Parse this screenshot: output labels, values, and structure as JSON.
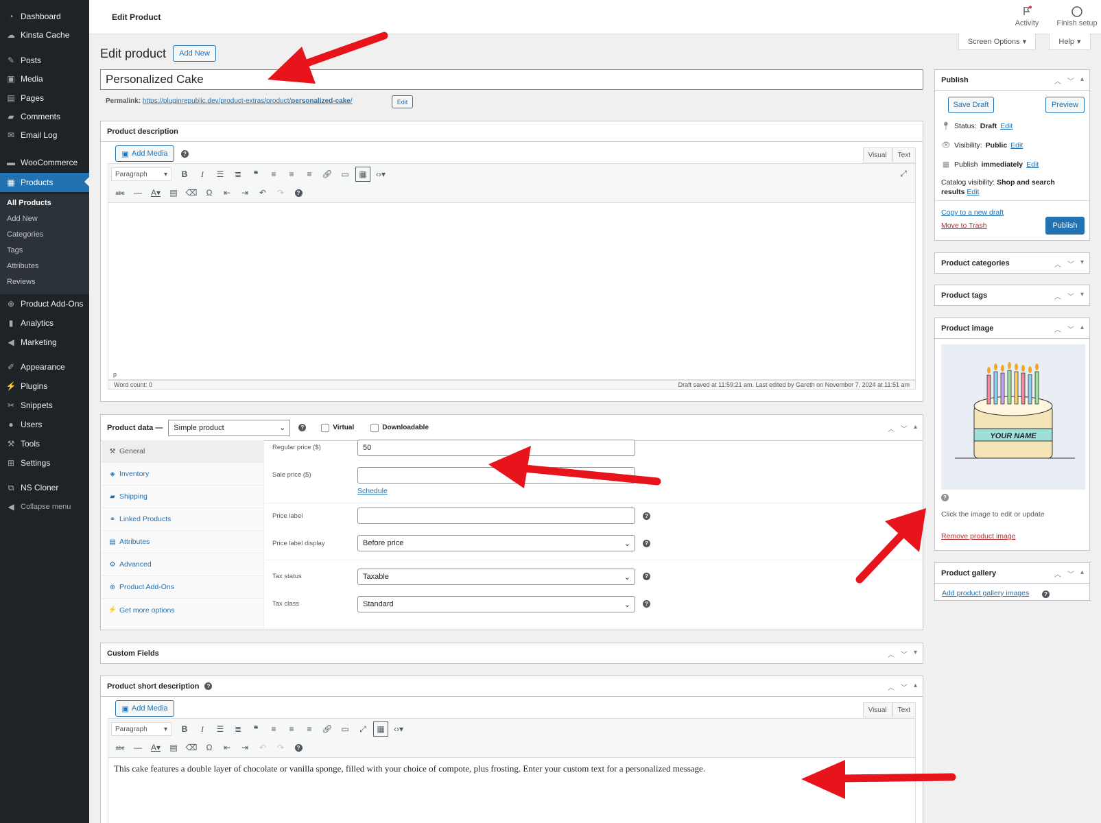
{
  "sidebar": {
    "menu": [
      {
        "label": "Dashboard",
        "icon": "dashboard-icon"
      },
      {
        "label": "Kinsta Cache",
        "icon": "cloud-icon"
      },
      {
        "label": "Posts",
        "icon": "pin-icon"
      },
      {
        "label": "Media",
        "icon": "media-icon"
      },
      {
        "label": "Pages",
        "icon": "pages-icon"
      },
      {
        "label": "Comments",
        "icon": "comments-icon"
      },
      {
        "label": "Email Log",
        "icon": "email-icon"
      },
      {
        "label": "WooCommerce",
        "icon": "woocommerce-icon"
      },
      {
        "label": "Products",
        "icon": "products-icon"
      },
      {
        "label": "Product Add-Ons",
        "icon": "plus-circle-icon"
      },
      {
        "label": "Analytics",
        "icon": "analytics-icon"
      },
      {
        "label": "Marketing",
        "icon": "megaphone-icon"
      },
      {
        "label": "Appearance",
        "icon": "brush-icon"
      },
      {
        "label": "Plugins",
        "icon": "plug-icon"
      },
      {
        "label": "Snippets",
        "icon": "scissors-icon"
      },
      {
        "label": "Users",
        "icon": "user-icon"
      },
      {
        "label": "Tools",
        "icon": "wrench-icon"
      },
      {
        "label": "Settings",
        "icon": "settings-icon"
      },
      {
        "label": "NS Cloner",
        "icon": "cloner-icon"
      },
      {
        "label": "Collapse menu",
        "icon": "collapse-icon"
      }
    ],
    "submenu": [
      "All Products",
      "Add New",
      "Categories",
      "Tags",
      "Attributes",
      "Reviews"
    ]
  },
  "topbar": {
    "title": "Edit Product",
    "activity": "Activity",
    "finish_setup": "Finish setup"
  },
  "screen_options": "Screen Options",
  "help": "Help",
  "heading": "Edit product",
  "add_new": "Add New",
  "post_title": "Personalized Cake",
  "permalink": {
    "label": "Permalink:",
    "url_base": "https://pluginrepublic.dev/product-extras/product/",
    "slug": "personalized-cake",
    "url_end": "/",
    "edit": "Edit"
  },
  "description": {
    "title": "Product description",
    "add_media": "Add Media",
    "tab_visual": "Visual",
    "tab_text": "Text",
    "format": "Paragraph",
    "path": "p",
    "word_count": "Word count: 0",
    "draft_saved": "Draft saved at 11:59:21 am. Last edited by Gareth on November 7, 2024 at 11:51 am"
  },
  "product_data": {
    "title": "Product data —",
    "type": "Simple product",
    "virtual": "Virtual",
    "downloadable": "Downloadable",
    "tabs": [
      {
        "label": "General",
        "icon": "wrench-icon"
      },
      {
        "label": "Inventory",
        "icon": "tag-icon"
      },
      {
        "label": "Shipping",
        "icon": "truck-icon"
      },
      {
        "label": "Linked Products",
        "icon": "link-icon"
      },
      {
        "label": "Attributes",
        "icon": "list-icon"
      },
      {
        "label": "Advanced",
        "icon": "gear-icon"
      },
      {
        "label": "Product Add-Ons",
        "icon": "plus-circle-icon"
      },
      {
        "label": "Get more options",
        "icon": "plug-icon"
      }
    ],
    "regular_price_label": "Regular price ($)",
    "regular_price": "50",
    "sale_price_label": "Sale price ($)",
    "sale_price": "",
    "schedule": "Schedule",
    "price_label_label": "Price label",
    "price_label": "",
    "price_label_display_label": "Price label display",
    "price_label_display": "Before price",
    "tax_status_label": "Tax status",
    "tax_status": "Taxable",
    "tax_class_label": "Tax class",
    "tax_class": "Standard"
  },
  "custom_fields": {
    "title": "Custom Fields"
  },
  "short_description": {
    "title": "Product short description",
    "add_media": "Add Media",
    "tab_visual": "Visual",
    "tab_text": "Text",
    "format": "Paragraph",
    "content": "This cake features a double layer of chocolate or vanilla sponge, filled with your choice of compote, plus frosting. Enter your custom text for a personalized message."
  },
  "publish": {
    "title": "Publish",
    "save_draft": "Save Draft",
    "preview": "Preview",
    "status_label": "Status:",
    "status": "Draft",
    "visibility_label": "Visibility:",
    "visibility": "Public",
    "publish_label": "Publish",
    "publish_when": "immediately",
    "catalog_label": "Catalog visibility:",
    "catalog": "Shop and search results",
    "edit": "Edit",
    "copy_draft": "Copy to a new draft",
    "trash": "Move to Trash",
    "publish_button": "Publish"
  },
  "categories": {
    "title": "Product categories"
  },
  "tags": {
    "title": "Product tags"
  },
  "product_image": {
    "title": "Product image",
    "cake_text": "YOUR NAME",
    "hint": "Click the image to edit or update",
    "remove": "Remove product image"
  },
  "gallery": {
    "title": "Product gallery",
    "add": "Add product gallery images"
  },
  "colors": {
    "admin_bar": "#1d2327",
    "accent": "#2271b1",
    "trash": "#b32d2e",
    "arrow": "#e8141b"
  }
}
